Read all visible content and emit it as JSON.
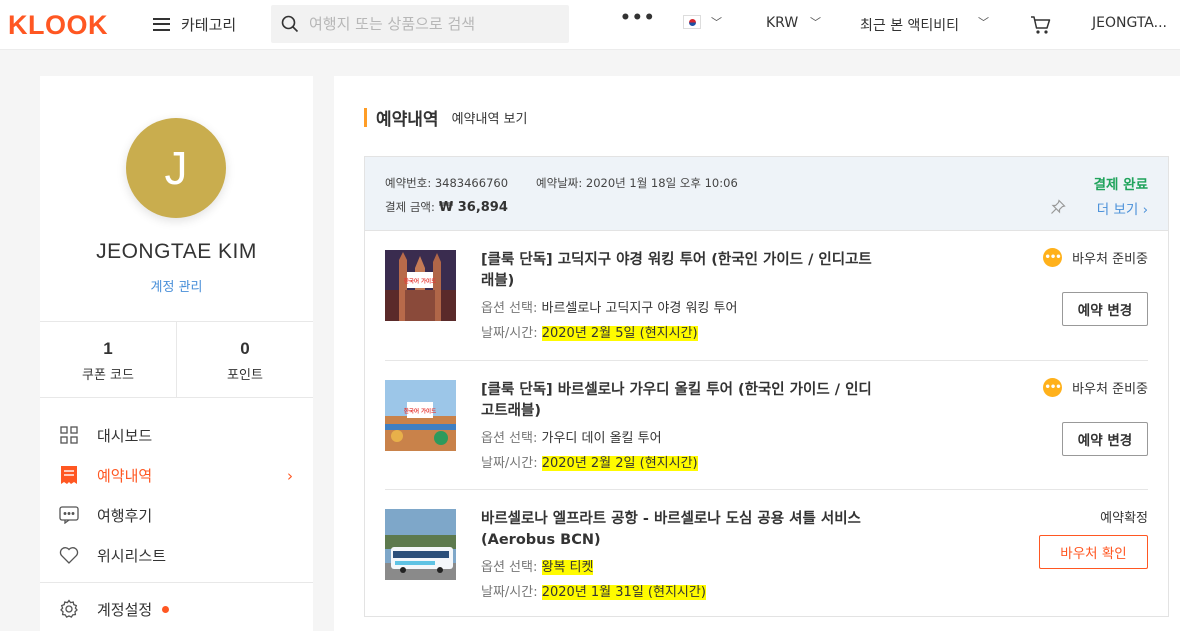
{
  "nav": {
    "logo": "KLOOK",
    "category_label": "카테고리",
    "search_placeholder": "여행지 또는 상품으로 검색",
    "more": "•••",
    "currency": "KRW",
    "recent": "최근 본 액티비티",
    "user": "JEONGTA..."
  },
  "sidebar": {
    "avatar_letter": "J",
    "avatar_color": "#c9ad4e",
    "name": "JEONGTAE KIM",
    "account_link": "계정 관리",
    "stats": [
      {
        "value": "1",
        "label": "쿠폰 코드"
      },
      {
        "value": "0",
        "label": "포인트"
      }
    ],
    "menu": [
      {
        "label": "대시보드",
        "icon": "dashboard-icon"
      },
      {
        "label": "예약내역",
        "icon": "booking-icon",
        "active": true
      },
      {
        "label": "여행후기",
        "icon": "review-icon"
      },
      {
        "label": "위시리스트",
        "icon": "heart-icon"
      },
      {
        "label": "계정설정",
        "icon": "gear-icon"
      }
    ]
  },
  "main": {
    "title": "예약내역",
    "subtitle": "예약내역 보기",
    "order": {
      "number_label": "예약번호: 3483466760",
      "date_label": "예약날짜: 2020년 1월 18일 오후 10:06",
      "amount_label": "결제 금액:",
      "amount": "₩ 36,894",
      "status": "결제 완료",
      "more": "더 보기",
      "items": [
        {
          "title": "[클룩 단독] 고딕지구 야경 워킹 투어 (한국인 가이드 / 인디고트래블)",
          "option_key": "옵션 선택: ",
          "option_val": "바르셀로나 고딕지구 야경 워킹 투어",
          "date_key": "날짜/시간: ",
          "date_val": "2020년 2월 5일 (현지시간)",
          "status": "바우처 준비중",
          "button": "예약 변경",
          "thumb_text": "한국어 가이드"
        },
        {
          "title": "[클룩 단독] 바르셀로나 가우디 올킬 투어 (한국인 가이드 / 인디고트래블)",
          "option_key": "옵션 선택: ",
          "option_val": "가우디 데이 올킬 투어",
          "date_key": "날짜/시간: ",
          "date_val": "2020년 2월 2일 (현지시간)",
          "status": "바우처 준비중",
          "button": "예약 변경",
          "thumb_text": "한국어 가이드"
        },
        {
          "title": "바르셀로나 엘프라트 공항 - 바르셀로나 도심 공용 셔틀 서비스 (Aerobus BCN)",
          "option_key": "옵션 선택: ",
          "option_val": "왕복 티켓",
          "date_key": "날짜/시간: ",
          "date_val": "2020년 1월 31일 (현지시간)",
          "status": "예약확정",
          "button": "바우처 확인"
        }
      ]
    }
  },
  "colors": {
    "brand": "#ff5722",
    "accent_bar": "#ff9d26",
    "paid": "#1fa35b",
    "link": "#4a90d9",
    "highlight": "#fffb00"
  }
}
